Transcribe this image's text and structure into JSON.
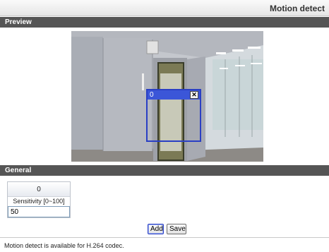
{
  "header": {
    "title": "Motion detect"
  },
  "sections": {
    "preview": "Preview",
    "general": "General"
  },
  "preview": {
    "image_description": "camera-feed",
    "detection_window": {
      "id_label": "0",
      "close_glyph": "✕",
      "border_color": "#2a3fc4"
    }
  },
  "general": {
    "region": {
      "id": "0",
      "sensitivity_label": "Sensitivity [0~100]",
      "sensitivity_value": "50"
    },
    "buttons": {
      "add": "Add",
      "save": "Save"
    }
  },
  "footer": {
    "note": "Motion detect is available for H.264 codec."
  },
  "colors": {
    "section_bar": "#555555",
    "accent": "#2a3fc4"
  }
}
